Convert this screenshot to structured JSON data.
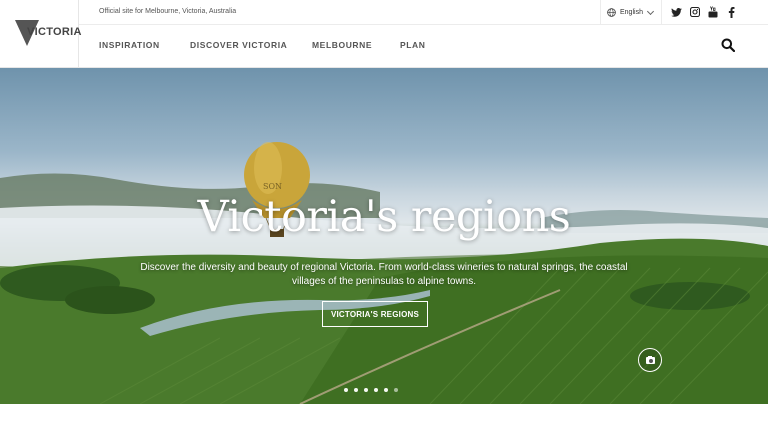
{
  "header": {
    "logo_text": "VICTORIA",
    "tagline": "Official site for Melbourne, Victoria, Australia",
    "language": "English",
    "social_icons": [
      "twitter-icon",
      "instagram-icon",
      "youtube-icon",
      "facebook-icon"
    ],
    "nav": [
      {
        "label": "INSPIRATION"
      },
      {
        "label": "DISCOVER VICTORIA"
      },
      {
        "label": "MELBOURNE"
      },
      {
        "label": "PLAN"
      }
    ]
  },
  "hero": {
    "title": "Victoria's regions",
    "subtitle": "Discover the diversity and beauty of regional Victoria. From world-class wineries to natural springs, the coastal villages of the peninsulas to alpine towns.",
    "button_label": "VICTORIA'S REGIONS",
    "balloon_text": "SON",
    "slide_count": 6,
    "active_slide": 1
  },
  "colors": {
    "nav_text": "#555555",
    "hero_text": "#ffffff"
  }
}
